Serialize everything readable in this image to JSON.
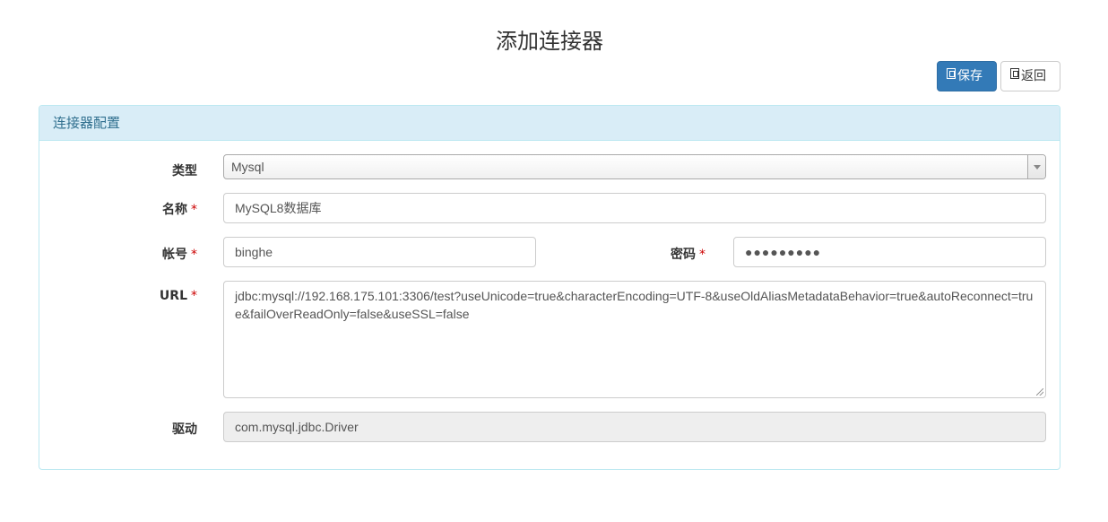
{
  "page": {
    "title": "添加连接器"
  },
  "toolbar": {
    "save_label": "保存",
    "back_label": "返回"
  },
  "panel": {
    "heading": "连接器配置",
    "fields": {
      "type": {
        "label": "类型",
        "value": "Mysql"
      },
      "name": {
        "label": "名称",
        "required": "*",
        "value": "MySQL8数据库"
      },
      "account": {
        "label": "帐号",
        "required": "*",
        "value": "binghe"
      },
      "password": {
        "label": "密码",
        "required": "*",
        "value": "●●●●●●●●●"
      },
      "url": {
        "label": "URL",
        "required": "*",
        "value": "jdbc:mysql://192.168.175.101:3306/test?useUnicode=true&characterEncoding=UTF-8&useOldAliasMetadataBehavior=true&autoReconnect=true&failOverReadOnly=false&useSSL=false"
      },
      "driver": {
        "label": "驱动",
        "value": "com.mysql.jdbc.Driver"
      }
    }
  },
  "colors": {
    "primary": "#337ab7",
    "panel_heading_bg": "#d9edf7",
    "panel_border": "#bce8f1",
    "panel_heading_text": "#31708f",
    "required": "#cc0000"
  },
  "icons": {
    "save": "save-icon",
    "back": "back-icon",
    "select_arrow": "chevron-down-icon"
  }
}
